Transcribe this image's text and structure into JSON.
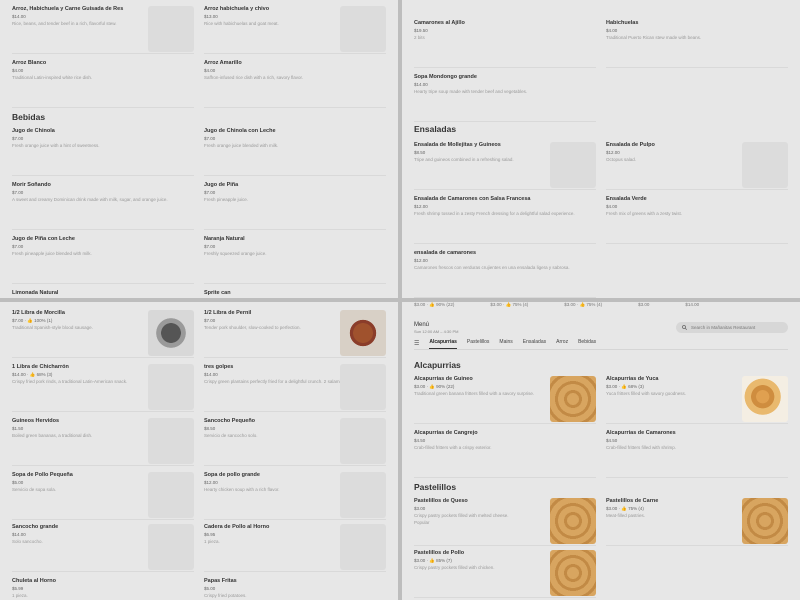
{
  "q1": {
    "cards": [
      {
        "name": "Arroz, Habichuela y Carne Guisada de Res",
        "price": "$14.00",
        "desc": "Rice, beans, and tender beef in a rich, flavorful stew."
      },
      {
        "name": "Arroz habichuela y chivo",
        "price": "$13.00",
        "desc": "Rice with habichuelas and goat meat."
      },
      {
        "name": "Arroz Blanco",
        "price": "$4.00",
        "desc": "Traditional Latin-inspired white rice dish."
      },
      {
        "name": "Arroz Amarillo",
        "price": "$4.00",
        "desc": "Saffron-infused rice dish with a rich, savory flavor."
      }
    ],
    "section": "Bebidas",
    "drinks": [
      {
        "name": "Jugo de Chinola",
        "price": "$7.00",
        "desc": "Fresh orange juice with a hint of sweetness."
      },
      {
        "name": "Jugo de Chinola con Leche",
        "price": "$7.00",
        "desc": "Fresh orange juice blended with milk."
      },
      {
        "name": "Morir Soñando",
        "price": "$7.00",
        "desc": "A sweet and creamy Dominican drink made with milk, sugar, and orange juice."
      },
      {
        "name": "Jugo de Piña",
        "price": "$7.00",
        "desc": "Fresh pineapple juice."
      },
      {
        "name": "Jugo de Piña con Leche",
        "price": "$7.00",
        "desc": "Fresh pineapple juice blended with milk."
      },
      {
        "name": "Naranja Natural",
        "price": "$7.00",
        "desc": "Freshly squeezed orange juice."
      },
      {
        "name": "Limonada Natural",
        "price": "",
        "desc": ""
      },
      {
        "name": "Sprite can",
        "price": "",
        "desc": ""
      }
    ]
  },
  "q2": {
    "cards": [
      {
        "name": "Camarones al Ajillo",
        "price": "$19.50",
        "desc": "2 bits"
      },
      {
        "name": "Habichuelas",
        "price": "$4.00",
        "desc": "Traditional Puerto Rican stew made with beans."
      },
      {
        "name": "Sopa Mondongo grande",
        "price": "$14.00",
        "desc": "Hearty tripe soup made with tender beef and vegetables."
      }
    ],
    "section": "Ensaladas",
    "salads": [
      {
        "name": "Ensalada de Mollejitas y Guineos",
        "price": "$8.50",
        "desc": "Tripe and guineos combined in a refreshing salad."
      },
      {
        "name": "Ensalada de Pulpo",
        "price": "$12.00",
        "desc": "Octopus salad."
      },
      {
        "name": "Ensalada de Camarones con Salsa Francesa",
        "price": "$12.00",
        "desc": "Fresh shrimp tossed in a zesty French dressing for a delightful salad experience."
      },
      {
        "name": "Ensalada Verde",
        "price": "$4.00",
        "desc": "Fresh mix of greens with a zesty twist."
      },
      {
        "name": "ensalada de camarones",
        "price": "$12.00",
        "desc": "Camarones frescos con verduras crujientes en una ensalada ligera y sabrosa."
      }
    ]
  },
  "q3": {
    "cards": [
      {
        "name": "1/2 Libra de Morcilla",
        "price": "$7.00 · 👍 100% (1)",
        "desc": "Traditional Spanish-style blood sausage."
      },
      {
        "name": "1/2 Libra de Pernil",
        "price": "$7.00",
        "desc": "Tender pork shoulder, slow-cooked to perfection."
      },
      {
        "name": "1 Libra de Chicharrón",
        "price": "$14.00 · 👍 68% (3)",
        "desc": "Crispy fried pork rinds, a traditional Latin-American snack."
      },
      {
        "name": "tres golpes",
        "price": "$14.00",
        "desc": "Crispy green plantains perfectly fried for a delightful crunch. 2 salami 1 friend 1 huevo"
      },
      {
        "name": "Guineos Hervidos",
        "price": "$1.50",
        "desc": "Boiled green bananas, a traditional dish."
      },
      {
        "name": "Sancocho Pequeño",
        "price": "$8.50",
        "desc": "Servicio de sancocho solo."
      },
      {
        "name": "Sopa de Pollo Pequeña",
        "price": "$5.00",
        "desc": "Servicio de sopa sola."
      },
      {
        "name": "Sopa de pollo grande",
        "price": "$12.00",
        "desc": "Hearty chicken soup with a rich flavor."
      },
      {
        "name": "Sancocho grande",
        "price": "$14.00",
        "desc": "Solo sancocho."
      },
      {
        "name": "Cadera de Pollo al Horno",
        "price": "$6.95",
        "desc": "1 pieza."
      },
      {
        "name": "Chuleta al Horno",
        "price": "$5.99",
        "desc": "1 pieza."
      },
      {
        "name": "Papas Fritas",
        "price": "$5.00",
        "desc": "Crispy fried potatoes."
      }
    ]
  },
  "q4": {
    "mini_prices": [
      "$3.00 · 👍 90% (22)",
      "$3.00 · 👍 75% (4)",
      "$3.00 · 👍 75% (4)",
      "$3.00",
      "$14.00"
    ],
    "menu_title": "Menú",
    "menu_hours": "Sun 12:00 AM – 4:30 PM",
    "search_placeholder": "Search in Mañanitas Restaurant",
    "tabs": [
      "Alcapurrias",
      "Pastelillos",
      "Mains",
      "Ensaladas",
      "Arroz",
      "Bebidas"
    ],
    "section1": "Alcapurrias",
    "alcapurrias": [
      {
        "name": "Alcapurrias de Guineo",
        "price": "$3.00 · 👍 90% (22)",
        "desc": "Traditional green banana fritters filled with a savory surprise."
      },
      {
        "name": "Alcapurrias de Yuca",
        "price": "$3.00 · 👍 68% (3)",
        "desc": "Yuca fritters filled with savory goodness."
      },
      {
        "name": "Alcapurrias de Cangrejo",
        "price": "$4.50",
        "desc": "Crab-filled fritters with a crispy exterior."
      },
      {
        "name": "Alcapurrias de Camarones",
        "price": "$4.50",
        "desc": "Crab-filled fritters filled with shrimp."
      }
    ],
    "section2": "Pastelillos",
    "pastelillos": [
      {
        "name": "Pastelillos de Queso",
        "price": "$3.00",
        "desc": "Crispy pastry pockets filled with melted cheese.",
        "tag": "Popular"
      },
      {
        "name": "Pastelillos de Carne",
        "price": "$3.00 · 👍 75% (4)",
        "desc": "Meat-filled pastries.",
        "tag": ""
      },
      {
        "name": "Pastelillos de Pollo",
        "price": "$3.00 · 👍 85% (7)",
        "desc": "Crispy pastry pockets filled with chicken.",
        "tag": ""
      }
    ]
  }
}
